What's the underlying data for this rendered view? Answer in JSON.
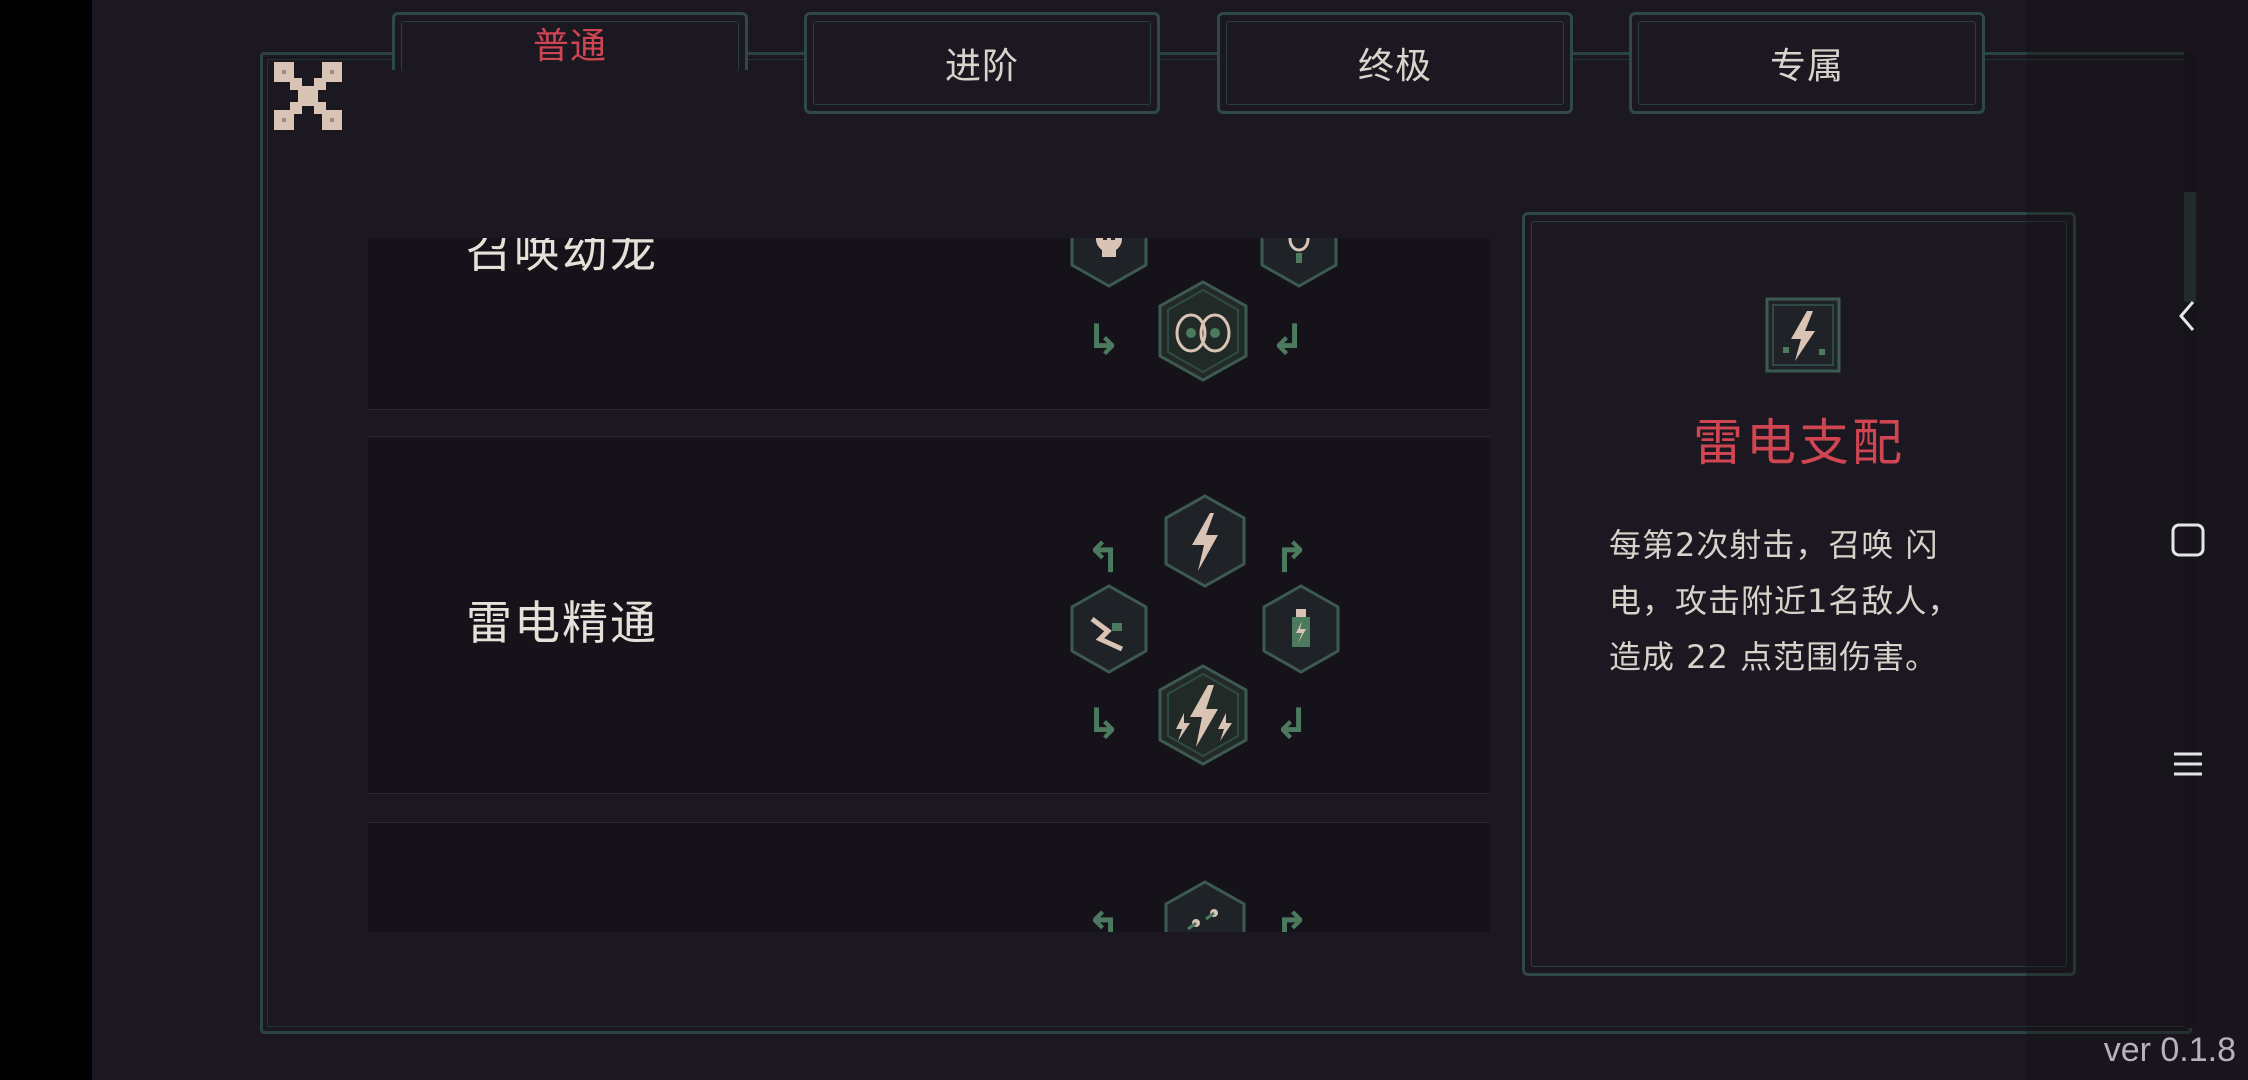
{
  "tabs": [
    {
      "label": "普通",
      "active": true
    },
    {
      "label": "进阶",
      "active": false
    },
    {
      "label": "终极",
      "active": false
    },
    {
      "label": "专属",
      "active": false
    }
  ],
  "skills": [
    {
      "name": "召唤幼龙",
      "icons": [
        "skull-icon",
        "egg-drop-icon",
        "dragon-eggs-icon"
      ]
    },
    {
      "name": "雷电精通",
      "icons": [
        "lightning-icon",
        "lightning-branch-icon",
        "lightning-potion-icon",
        "lightning-mastery-icon"
      ]
    },
    {
      "name": "",
      "icons": [
        "spark-icon"
      ]
    }
  ],
  "detail": {
    "icon": "lightning-icon",
    "title": "雷电支配",
    "description_lines": [
      "每第2次射击，召唤 闪",
      "电，攻击附近1名敌人，",
      "造成 22 点范围伤害。"
    ]
  },
  "colors": {
    "accent_red": "#cf4552",
    "frame_teal": "#2f4a46",
    "arrow_green": "#4b7a5e",
    "background": "#1c1821"
  },
  "version": "ver 0.1.8"
}
